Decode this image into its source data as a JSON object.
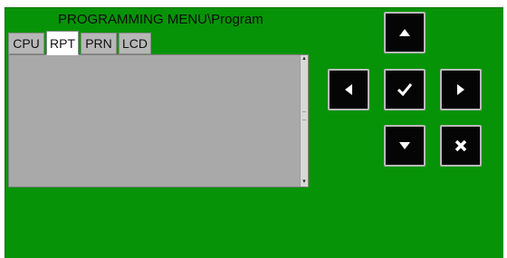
{
  "menu": {
    "title": "PROGRAMMING MENU\\Program"
  },
  "tabs": [
    {
      "label": "CPU",
      "active": false
    },
    {
      "label": "RPT",
      "active": true
    },
    {
      "label": "PRN",
      "active": false
    },
    {
      "label": "LCD",
      "active": false
    }
  ],
  "list": {
    "items": []
  },
  "nav": {
    "up": {
      "icon": "arrow-up-icon"
    },
    "left": {
      "icon": "arrow-left-icon"
    },
    "ok": {
      "icon": "checkmark-icon"
    },
    "right": {
      "icon": "arrow-right-icon"
    },
    "down": {
      "icon": "arrow-down-icon"
    },
    "cancel": {
      "icon": "close-x-icon"
    }
  },
  "colors": {
    "panel": "#079307",
    "button": "#050505",
    "list_bg": "#a9a9a9",
    "tab_active": "#ffffff",
    "tab_inactive": "#b7b7b7"
  }
}
